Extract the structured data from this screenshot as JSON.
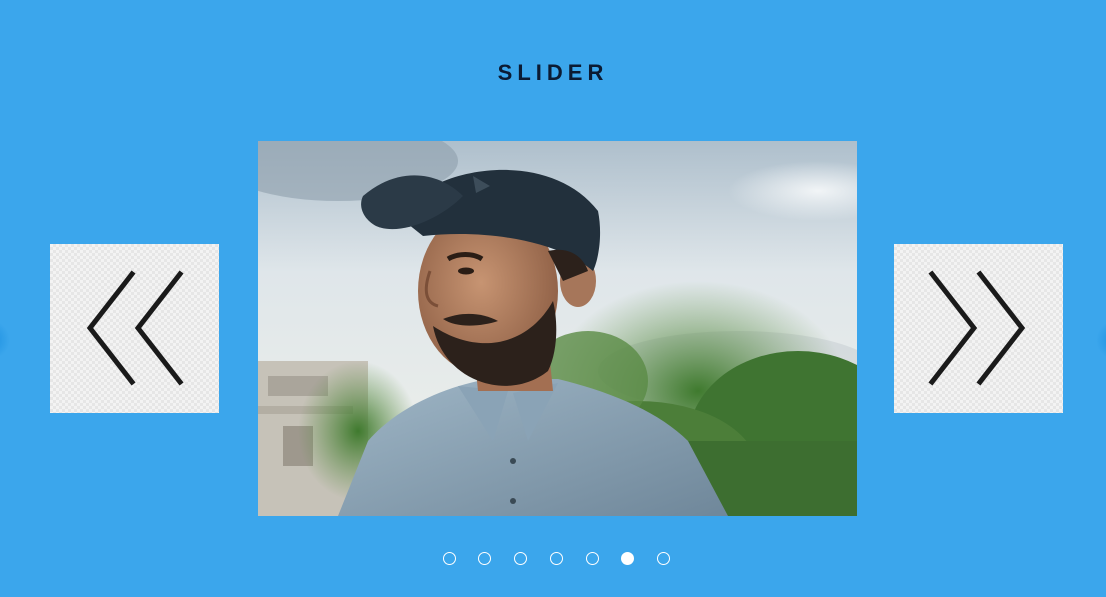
{
  "header": {
    "title": "SLIDER"
  },
  "slider": {
    "prev_icon": "double-chevron-left-icon",
    "next_icon": "double-chevron-right-icon",
    "dot_count": 7,
    "active_index": 5,
    "colors": {
      "background": "#3ba6ec",
      "title": "#0b1b33",
      "dot": "#ffffff",
      "button_bg": "#f3f3f3",
      "arrow": "#1a1a1a"
    }
  }
}
